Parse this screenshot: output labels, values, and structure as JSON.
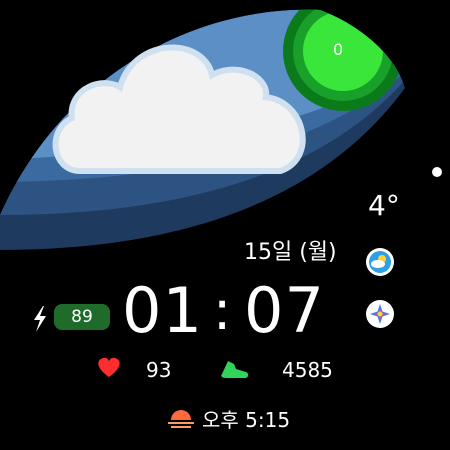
{
  "weather": {
    "temperature": "4°",
    "condition_icon": "cloud-icon"
  },
  "ring": {
    "value": "0"
  },
  "date": {
    "label": "15일 (월)"
  },
  "time": {
    "hours": "01",
    "separator": ":",
    "minutes": "07"
  },
  "battery": {
    "icon": "bolt-icon",
    "value": "89"
  },
  "heart_rate": {
    "icon": "heart-icon",
    "value": "93"
  },
  "steps": {
    "icon": "shoe-icon",
    "value": "4585"
  },
  "sunset": {
    "icon": "sunset-icon",
    "label": "오후 5:15"
  },
  "complications": {
    "weather_app_icon": "weather-app-icon",
    "bixby_icon": "sparkle-app-icon"
  },
  "colors": {
    "leaf_outer": "#1e3a5e",
    "leaf_mid": "#3a6aa0",
    "leaf_inner": "#5b8fc6",
    "ring_green": "#39e639",
    "battery_badge": "#1f6b2a",
    "heart": "#ff2d2d",
    "steps": "#31d45a"
  }
}
